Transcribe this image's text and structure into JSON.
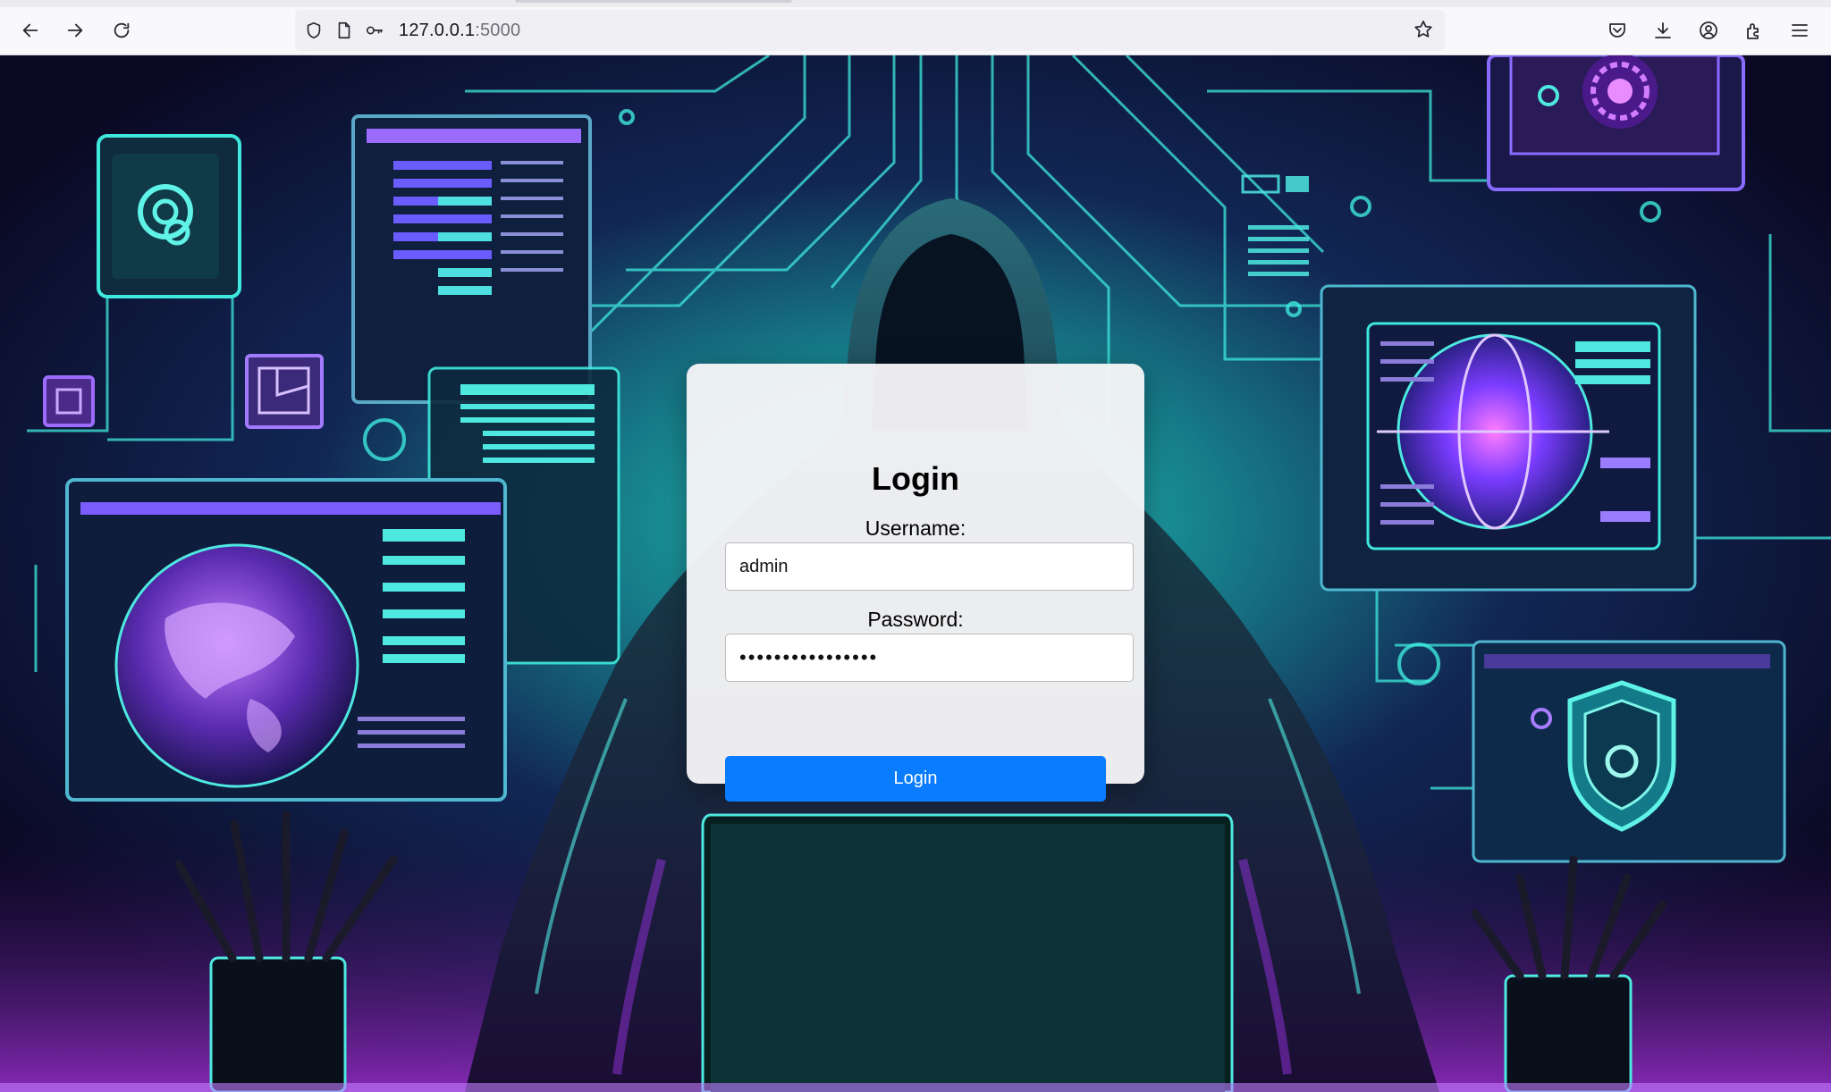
{
  "browser": {
    "url_host": "127.0.0.1",
    "url_port": ":5000",
    "icons": [
      "back-arrow-icon",
      "forward-arrow-icon",
      "reload-icon",
      "shield-icon",
      "page-icon",
      "key-icon",
      "bookmark-star-icon",
      "pocket-icon",
      "download-icon",
      "account-icon",
      "extensions-icon",
      "menu-icon"
    ]
  },
  "login": {
    "title": "Login",
    "username_label": "Username:",
    "username_value": "admin",
    "password_label": "Password:",
    "password_value": "••••••••••••••••",
    "button_label": "Login"
  },
  "colors": {
    "button": "#0a7cff",
    "neon_teal": "#2fe0d6",
    "neon_purple": "#a64dff",
    "background_dark": "#0b0a24"
  }
}
